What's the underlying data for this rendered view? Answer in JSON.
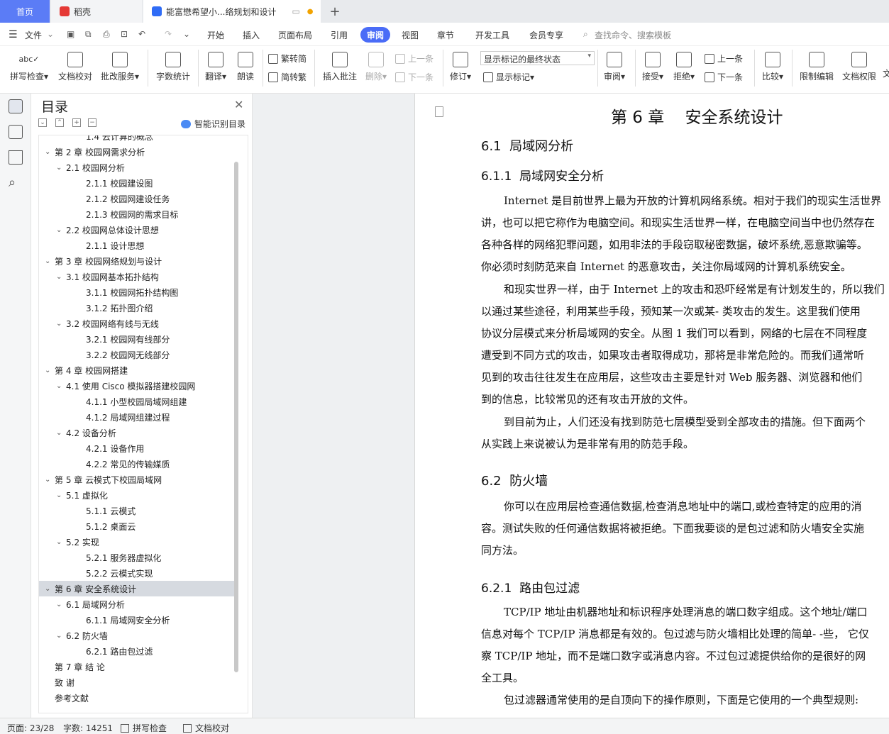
{
  "tabs": {
    "home": "首页",
    "daoke": "稻壳",
    "doc": "能富懋希望小...络规划和设计"
  },
  "menu": {
    "file": "文件",
    "items": [
      "开始",
      "插入",
      "页面布局",
      "引用",
      "审阅",
      "视图",
      "章节",
      "开发工具",
      "会员专享"
    ],
    "active": "审阅",
    "search": "查找命令、搜索模板"
  },
  "ribbon": {
    "spell_check": "拼写检查",
    "doc_check": "文档校对",
    "batch_service": "批改服务",
    "word_count": "字数统计",
    "translate": "翻译",
    "read_aloud": "朗读",
    "trad_to_simp": "繁转简",
    "simp_to_trad": "简转繁",
    "insert_comment": "插入批注",
    "delete": "删除",
    "prev_comment": "上一条",
    "next_comment": "下一条",
    "revise": "修订",
    "markup_mode": "显示标记的最终状态",
    "show_markup": "显示标记",
    "review": "审阅",
    "accept": "接受",
    "reject": "拒绝",
    "prev_change": "上一条",
    "next_change": "下一条",
    "compare": "比较",
    "restrict_edit": "限制编辑",
    "doc_permission": "文档权限",
    "more": "文"
  },
  "toc": {
    "title": "目录",
    "smart": "智能识别目录",
    "items": [
      {
        "text": "1.4  云计算的概念",
        "level": 3,
        "chev": ""
      },
      {
        "text": "第 2 章    校园网需求分析",
        "level": 1,
        "chev": "v"
      },
      {
        "text": "2.1  校园网分析",
        "level": 2,
        "chev": "v"
      },
      {
        "text": "2.1.1  校园建设图",
        "level": 3,
        "chev": ""
      },
      {
        "text": "2.1.2  校园网建设任务",
        "level": 3,
        "chev": ""
      },
      {
        "text": "2.1.3  校园网的需求目标",
        "level": 3,
        "chev": ""
      },
      {
        "text": "2.2  校园网总体设计思想",
        "level": 2,
        "chev": "v"
      },
      {
        "text": "2.1.1  设计思想",
        "level": 3,
        "chev": ""
      },
      {
        "text": "第 3 章    校园网络规划与设计",
        "level": 1,
        "chev": "v"
      },
      {
        "text": "3.1  校园网基本拓扑结构",
        "level": 2,
        "chev": "v"
      },
      {
        "text": "3.1.1  校园网拓扑结构图",
        "level": 3,
        "chev": ""
      },
      {
        "text": "3.1.2  拓扑图介绍",
        "level": 3,
        "chev": ""
      },
      {
        "text": "3.2  校园网络有线与无线",
        "level": 2,
        "chev": "v"
      },
      {
        "text": "3.2.1  校园网有线部分",
        "level": 3,
        "chev": ""
      },
      {
        "text": "3.2.2  校园网无线部分",
        "level": 3,
        "chev": ""
      },
      {
        "text": "第 4 章    校园网搭建",
        "level": 1,
        "chev": "v"
      },
      {
        "text": "4.1  使用 Cisco 模拟器搭建校园网",
        "level": 2,
        "chev": "v"
      },
      {
        "text": "4.1.1  小型校园局域网组建",
        "level": 3,
        "chev": ""
      },
      {
        "text": "4.1.2  局域网组建过程",
        "level": 3,
        "chev": ""
      },
      {
        "text": "4.2  设备分析",
        "level": 2,
        "chev": "v"
      },
      {
        "text": "4.2.1 设备作用",
        "level": 3,
        "chev": ""
      },
      {
        "text": "4.2.2 常见的传输媒质",
        "level": 3,
        "chev": ""
      },
      {
        "text": "第 5 章    云模式下校园局域网",
        "level": 1,
        "chev": "v"
      },
      {
        "text": "5.1  虚拟化",
        "level": 2,
        "chev": "v"
      },
      {
        "text": "5.1.1  云模式",
        "level": 3,
        "chev": ""
      },
      {
        "text": "5.1.2  桌面云",
        "level": 3,
        "chev": ""
      },
      {
        "text": "5.2  实现",
        "level": 2,
        "chev": "v"
      },
      {
        "text": "5.2.1  服务器虚拟化",
        "level": 3,
        "chev": ""
      },
      {
        "text": "5.2.2  云模式实现",
        "level": 3,
        "chev": ""
      },
      {
        "text": "第 6 章    安全系统设计",
        "level": 1,
        "chev": "v",
        "selected": true
      },
      {
        "text": "6.1  局域网分析",
        "level": 2,
        "chev": "v"
      },
      {
        "text": "6.1.1  局域网安全分析",
        "level": 3,
        "chev": ""
      },
      {
        "text": "6.2  防火墙",
        "level": 2,
        "chev": "v"
      },
      {
        "text": "6.2.1  路由包过滤",
        "level": 3,
        "chev": ""
      },
      {
        "text": "第 7 章    结    论",
        "level": 1,
        "chev": ""
      },
      {
        "text": "致    谢",
        "level": 1,
        "chev": ""
      },
      {
        "text": "参考文献",
        "level": 1,
        "chev": ""
      }
    ]
  },
  "doc": {
    "chapter": "第 6 章    安全系统设计",
    "s61": "6.1  局域网分析",
    "s611": "6.1.1  局域网安全分析",
    "p1": [
      "Internet 是目前世界上最为开放的计算机网络系统。相对于我们的现实生活世界",
      "讲，也可以把它称作为电脑空间。和现实生活世界一样，在电脑空间当中也仍然存在",
      "各种各样的网络犯罪问题，如用非法的手段窃取秘密数据，破坏系统,恶意欺骗等。",
      "你必须时刻防范来自 Internet 的恶意攻击，关注你局域网的计算机系统安全。"
    ],
    "p2": [
      "和现实世界一样，由于 Internet 上的攻击和恐吓经常是有计划发生的，所以我们",
      "以通过某些途径，利用某些手段，预知某一次或某- 类攻击的发生。这里我们使用",
      "协议分层模式来分析局域网的安全。从图 1 我们可以看到，网络的七层在不同程度",
      "遭受到不同方式的攻击，如果攻击者取得成功，那将是非常危险的。而我们通常听",
      "见到的攻击往往发生在应用层，这些攻击主要是针对 Web 服务器、浏览器和他们",
      "到的信息，比较常见的还有攻击开放的文件。"
    ],
    "p3": [
      "到目前为止，人们还没有找到防范七层模型受到全部攻击的措施。但下面两个",
      "从实践上来说被认为是非常有用的防范手段。"
    ],
    "s62": "6.2  防火墙",
    "p4": [
      "你可以在应用层检查通信数据,检查消息地址中的端口,或检查特定的应用的消",
      "容。测试失败的任何通信数据将被拒绝。下面我要谈的是包过滤和防火墙安全实施",
      "同方法。"
    ],
    "s621": "6.2.1  路由包过滤",
    "p5": [
      "TCP/IP 地址由机器地址和标识程序处理消息的端口数字组成。这个地址/端口",
      "信息对每个 TCP/IP 消息都是有效的。包过滤与防火墙相比处理的简单- -些，  它仅",
      "察 TCP/IP 地址，而不是端口数字或消息内容。不过包过滤提供给你的是很好的网",
      "全工具。"
    ],
    "p6": [
      "包过滤器通常使用的是自顶向下的操作原则，下面是它使用的一个典型规则:"
    ]
  },
  "status": {
    "page": "页面: 23/28",
    "words": "字数: 14251",
    "spell": "拼写检查",
    "proof": "文档校对"
  }
}
